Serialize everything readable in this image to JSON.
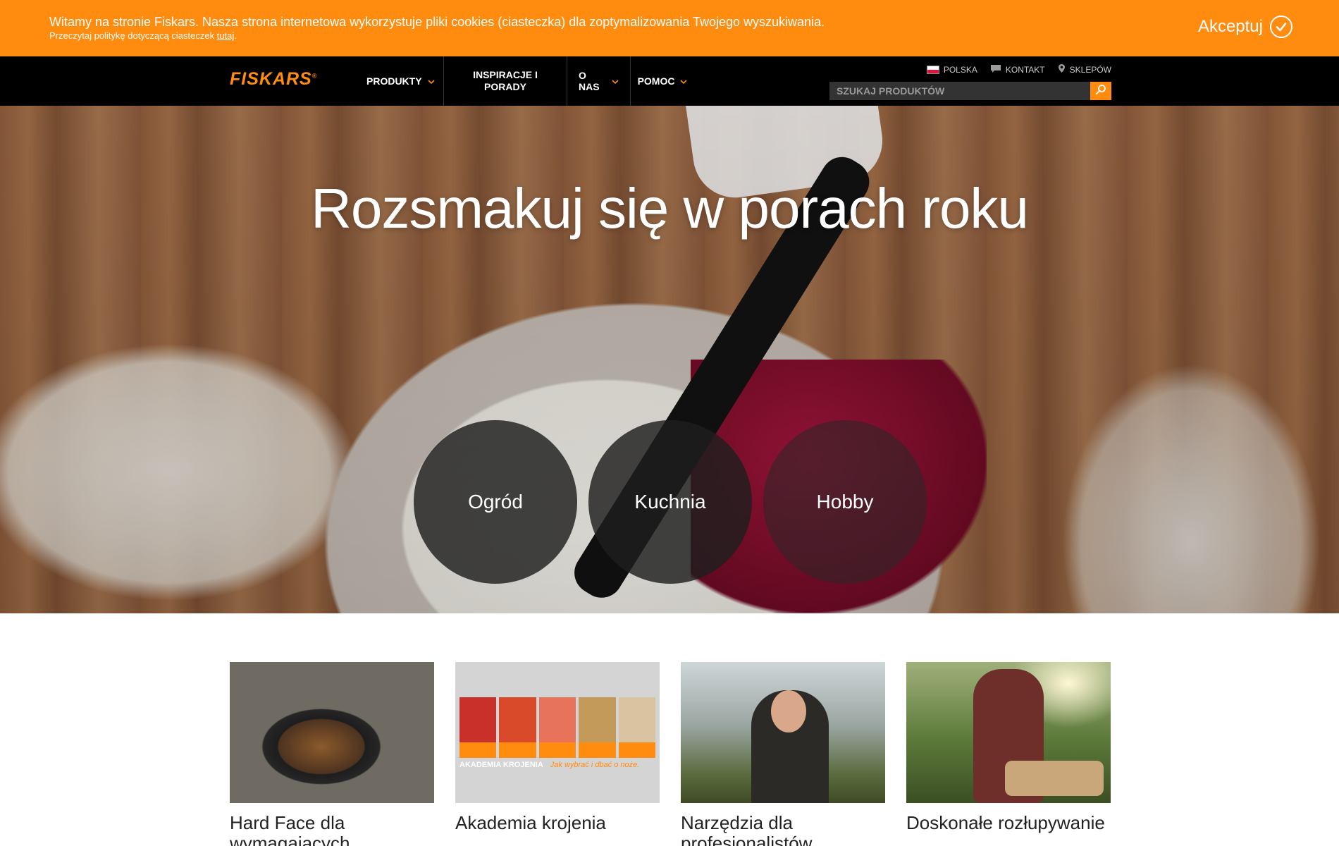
{
  "cookie": {
    "message": "Witamy na stronie Fiskars. Nasza strona internetowa wykorzystuje pliki cookies (ciasteczka) dla zoptymalizowania Twojego wyszukiwania.",
    "policy_text": "Przeczytaj politykę dotyczącą ciasteczek ",
    "policy_link": "tutaj",
    "accept_label": "Akceptuj"
  },
  "nav": {
    "logo": "FISKARS",
    "items": [
      {
        "label": "PRODUKTY",
        "dropdown": true
      },
      {
        "label": "INSPIRACJE I PORADY",
        "dropdown": false
      },
      {
        "label": "O NAS",
        "dropdown": true
      },
      {
        "label": "POMOC",
        "dropdown": true
      }
    ],
    "utility": {
      "country": "POLSKA",
      "contact": "KONTAKT",
      "stores": "SKLEPÓW"
    },
    "search": {
      "placeholder": "SZUKAJ PRODUKTÓW"
    }
  },
  "hero": {
    "title": "Rozsmakuj się w porach roku",
    "circles": [
      "Ogród",
      "Kuchnia",
      "Hobby"
    ]
  },
  "cards": [
    {
      "title": "Hard Face dla wymagających miłośników"
    },
    {
      "title": "Akademia krojenia",
      "image_caption": "AKADEMIA KROJENIA",
      "image_subcaption": "Jak wybrać i dbać o noże."
    },
    {
      "title": "Narzędzia dla profesjonalistów"
    },
    {
      "title": "Doskonałe rozłupywanie"
    }
  ],
  "colors": {
    "accent": "#ff8b0f",
    "nav_bg": "#000000"
  }
}
